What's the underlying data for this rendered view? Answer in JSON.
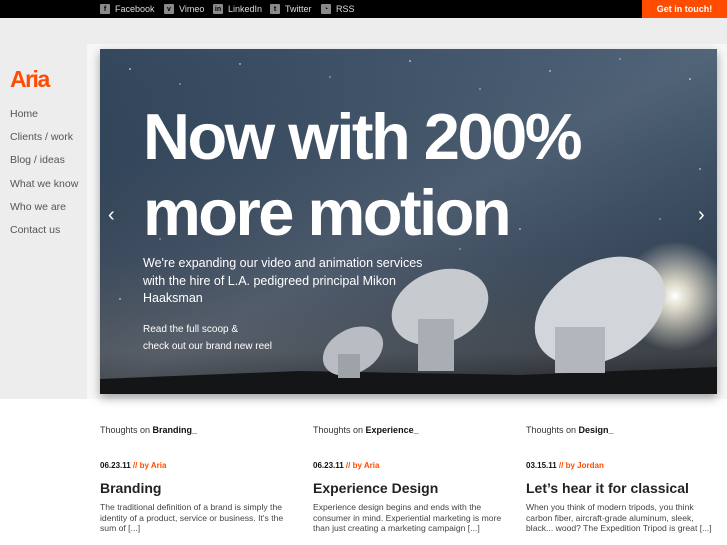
{
  "social": [
    {
      "label": "Facebook",
      "icon": "facebook-icon",
      "glyph": "f"
    },
    {
      "label": "Vimeo",
      "icon": "vimeo-icon",
      "glyph": "v"
    },
    {
      "label": "LinkedIn",
      "icon": "linkedin-icon",
      "glyph": "in"
    },
    {
      "label": "Twitter",
      "icon": "twitter-icon",
      "glyph": "t"
    },
    {
      "label": "RSS",
      "icon": "rss-icon",
      "glyph": "◔"
    }
  ],
  "cta_label": "Get in touch!",
  "logo": "Aria",
  "nav": [
    "Home",
    "Clients / work",
    "Blog / ideas",
    "What we know",
    "Who we are",
    "Contact us"
  ],
  "hero": {
    "line1": "Now with 200%",
    "line2": "more motion",
    "sub": "We're expanding our video and animation services with the hire of L.A. pedigreed principal Mikon Haaksman",
    "link1": "Read the full scoop &",
    "link2": "check out our brand new reel",
    "prev": "‹",
    "next": "›"
  },
  "posts": [
    {
      "thoughts_prefix": "Thoughts on ",
      "topic": "Branding_",
      "date": "06.23.11",
      "sep": " // ",
      "by": "by Aria",
      "title": "Branding",
      "excerpt": "The traditional definition of a brand is simply the identity of a product, service or business. It's the sum of [...]"
    },
    {
      "thoughts_prefix": "Thoughts on ",
      "topic": "Experience_",
      "date": "06.23.11",
      "sep": " // ",
      "by": "by Aria",
      "title": "Experience Design",
      "excerpt": "Experience design begins and ends with the consumer in mind. Experiential marketing is more than just creating a marketing campaign [...]"
    },
    {
      "thoughts_prefix": "Thoughts on ",
      "topic": "Design_",
      "date": "03.15.11",
      "sep": " // ",
      "by": "by Jordan",
      "title": "Let’s hear it for classical",
      "excerpt": "When you think of modern tripods, you think carbon fiber, aircraft-grade aluminum, sleek, black... wood? The Expedition Tripod is great [...]"
    }
  ],
  "colors": {
    "accent": "#ff4c00",
    "topbar": "#000000",
    "sidebar": "#ededed"
  }
}
